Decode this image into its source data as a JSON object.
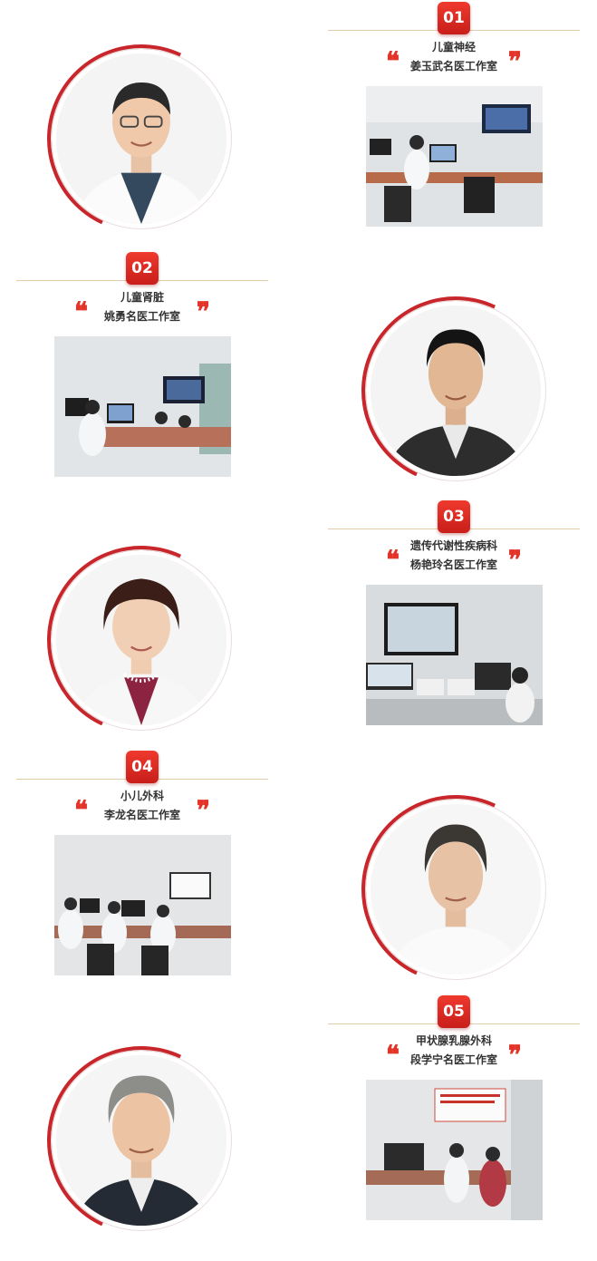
{
  "colors": {
    "accent": "#c8262b",
    "badge": "#e3342a",
    "rule": "#e3cda8",
    "text": "#333333"
  },
  "quote_open": "❝",
  "quote_close": "❞",
  "studios": [
    {
      "number": "01",
      "specialty": "儿童神经",
      "name": "姜玉武名医工作室"
    },
    {
      "number": "02",
      "specialty": "儿童肾脏",
      "name": "姚勇名医工作室"
    },
    {
      "number": "03",
      "specialty": "遗传代谢性疾病科",
      "name": "杨艳玲名医工作室"
    },
    {
      "number": "04",
      "specialty": "小儿外科",
      "name": "李龙名医工作室"
    },
    {
      "number": "05",
      "specialty": "甲状腺乳腺外科",
      "name": "段学宁名医工作室"
    }
  ]
}
